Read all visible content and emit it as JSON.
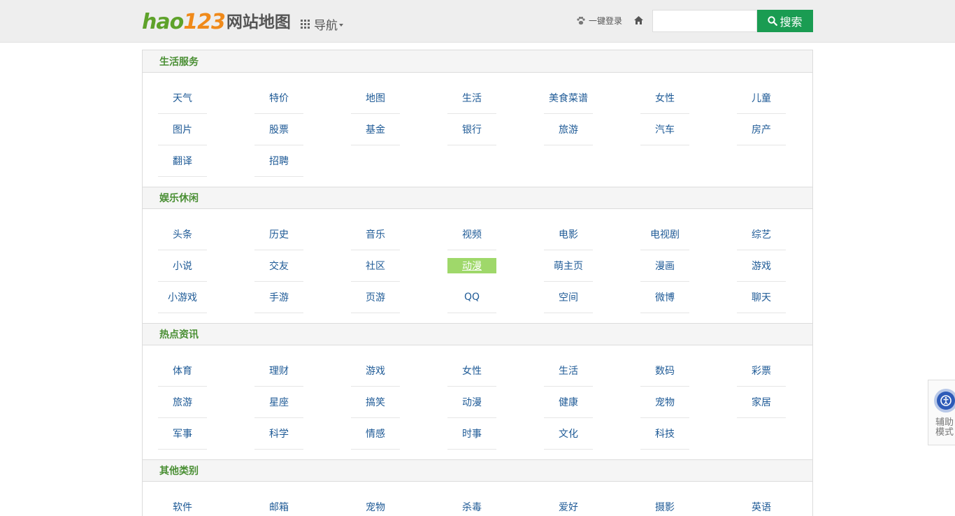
{
  "header": {
    "logo_hao": "hao",
    "logo_num": "123",
    "logo_title": "网站地图",
    "nav_label": "导航",
    "login_label": "一键登录",
    "search": {
      "value": "",
      "placeholder": ""
    },
    "search_button_label": "搜索",
    "colors": {
      "accent": "#1a9c52",
      "section_title": "#4a8f34",
      "link": "#1e5a96",
      "active_bg": "#9fd86a"
    }
  },
  "sections": [
    {
      "title": "生活服务",
      "links": [
        "天气",
        "特价",
        "地图",
        "生活",
        "美食菜谱",
        "女性",
        "儿童",
        "图片",
        "股票",
        "基金",
        "银行",
        "旅游",
        "汽车",
        "房产",
        "翻译",
        "招聘"
      ]
    },
    {
      "title": "娱乐休闲",
      "links": [
        "头条",
        "历史",
        "音乐",
        "视频",
        "电影",
        "电视剧",
        "综艺",
        "小说",
        "交友",
        "社区",
        "动漫",
        "萌主页",
        "漫画",
        "游戏",
        "小游戏",
        "手游",
        "页游",
        "QQ",
        "空间",
        "微博",
        "聊天"
      ],
      "active_index": 10
    },
    {
      "title": "热点资讯",
      "links": [
        "体育",
        "理财",
        "游戏",
        "女性",
        "生活",
        "数码",
        "彩票",
        "旅游",
        "星座",
        "搞笑",
        "动漫",
        "健康",
        "宠物",
        "家居",
        "军事",
        "科学",
        "情感",
        "时事",
        "文化",
        "科技"
      ]
    },
    {
      "title": "其他类别",
      "links": [
        "软件",
        "邮箱",
        "宠物",
        "杀毒",
        "爱好",
        "摄影",
        "英语"
      ]
    }
  ],
  "assist": {
    "label": "辅助模式"
  }
}
